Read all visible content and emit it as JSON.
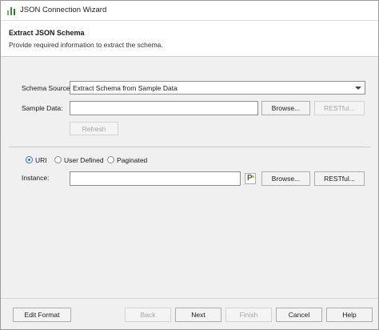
{
  "window": {
    "title": "JSON Connection Wizard"
  },
  "header": {
    "title": "Extract JSON Schema",
    "subtitle": "Provide required information to extract the schema."
  },
  "schema_source": {
    "label": "Schema Source:",
    "value": "Extract Schema from Sample Data"
  },
  "sample_data": {
    "label": "Sample Data:",
    "value": "",
    "browse_label": "Browse...",
    "restful_label": "RESTful...",
    "refresh_label": "Refresh"
  },
  "instance_type": {
    "options": [
      "URI",
      "User Defined",
      "Paginated"
    ],
    "selected": "URI"
  },
  "instance": {
    "label": "Instance:",
    "value": "",
    "browse_label": "Browse...",
    "restful_label": "RESTful..."
  },
  "footer": {
    "edit_format_label": "Edit Format",
    "back_label": "Back",
    "next_label": "Next",
    "finish_label": "Finish",
    "cancel_label": "Cancel",
    "help_label": "Help"
  }
}
